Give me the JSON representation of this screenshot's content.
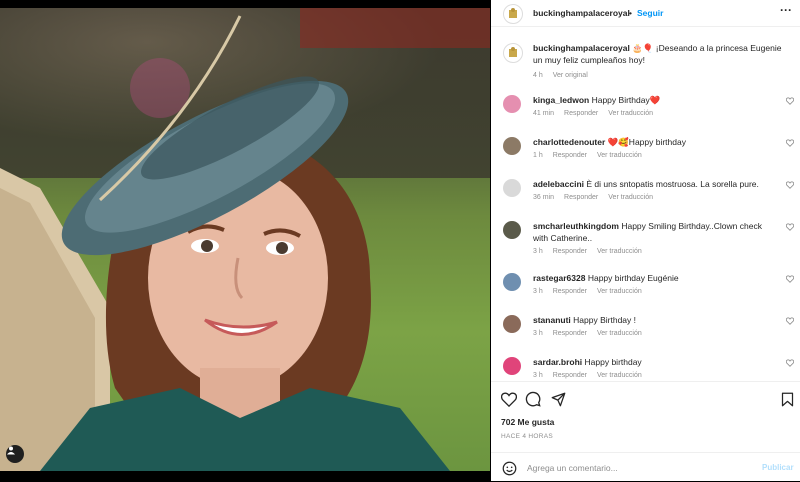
{
  "post": {
    "username": "buckinghampalaceroyal",
    "follow_label": "Seguir",
    "more_icon": "more-horizontal-icon"
  },
  "caption": {
    "username": "buckinghampalaceroyal",
    "emoji": "🎂🎈",
    "text": "¡Deseando a la princesa Eugenie un muy feliz cumpleaños hoy!",
    "time": "4 h",
    "see_original": "Ver original"
  },
  "comments": [
    {
      "username": "kinga_ledwon",
      "text": "Happy Birthday❤️",
      "time": "41 min",
      "reply": "Responder",
      "translate": "Ver traducción",
      "avatar_color": "#e58fb0"
    },
    {
      "username": "charlottedenouter",
      "text": "❤️🥰Happy birthday",
      "time": "1 h",
      "reply": "Responder",
      "translate": "Ver traducción",
      "avatar_color": "#8c7a66"
    },
    {
      "username": "adelebaccini",
      "text": "È di uns sntopatis mostruosa. La sorella pure.",
      "time": "36 min",
      "reply": "Responder",
      "translate": "Ver traducción",
      "avatar_color": "#d9d9d9"
    },
    {
      "username": "smcharleuthkingdom",
      "text": "Happy Smiling Birthday..Clown check with Catherine..",
      "time": "3 h",
      "reply": "Responder",
      "translate": "Ver traducción",
      "avatar_color": "#5a5a4a"
    },
    {
      "username": "rastegar6328",
      "text": "Happy birthday Eugénie",
      "time": "3 h",
      "reply": "Responder",
      "translate": "Ver traducción",
      "avatar_color": "#6f8fb0"
    },
    {
      "username": "stananuti",
      "text": "Happy Birthday !",
      "time": "3 h",
      "reply": "Responder",
      "translate": "Ver traducción",
      "avatar_color": "#8a6a5a"
    },
    {
      "username": "sardar.brohi",
      "text": "Happy birthday",
      "time": "3 h",
      "reply": "Responder",
      "translate": "Ver traducción",
      "avatar_color": "#e0447a"
    }
  ],
  "likes": "702 Me gusta",
  "posted_ago": "HACE 4 HORAS",
  "add_comment": {
    "placeholder": "Agrega un comentario...",
    "publish": "Publicar"
  },
  "colors": {
    "link": "#0095f6",
    "muted": "#8e8e8e",
    "text": "#262626"
  }
}
